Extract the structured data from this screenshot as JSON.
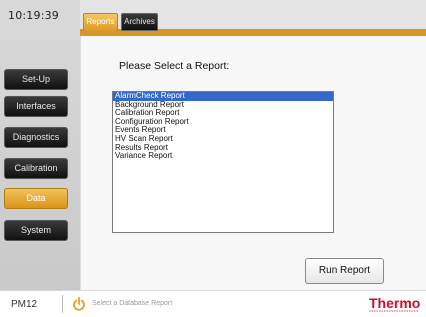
{
  "clock": "10:19:39",
  "sidebar": {
    "items": [
      {
        "label": "Set-Up",
        "active": false
      },
      {
        "label": "Interfaces",
        "active": false
      },
      {
        "label": "Diagnostics",
        "active": false
      },
      {
        "label": "Calibration",
        "active": false
      },
      {
        "label": "Data",
        "active": true
      },
      {
        "label": "System",
        "active": false
      }
    ]
  },
  "tabs": [
    {
      "label": "Reports",
      "active": true
    },
    {
      "label": "Archives",
      "active": false
    }
  ],
  "main": {
    "prompt": "Please Select a Report:",
    "reports": [
      "AlarmCheck Report",
      "Background Report",
      "Calibration Report",
      "Configuration Report",
      "Events Report",
      "HV Scan Report",
      "Results Report",
      "Variance Report"
    ],
    "selected_index": 0,
    "run_button": "Run Report"
  },
  "status": {
    "model": "PM12",
    "message": "Select a Database Report"
  },
  "brand": {
    "logo_text": "Thermo",
    "logo_color": "#c8102e",
    "accent": "#d8951a",
    "selection": "#3367c8"
  }
}
